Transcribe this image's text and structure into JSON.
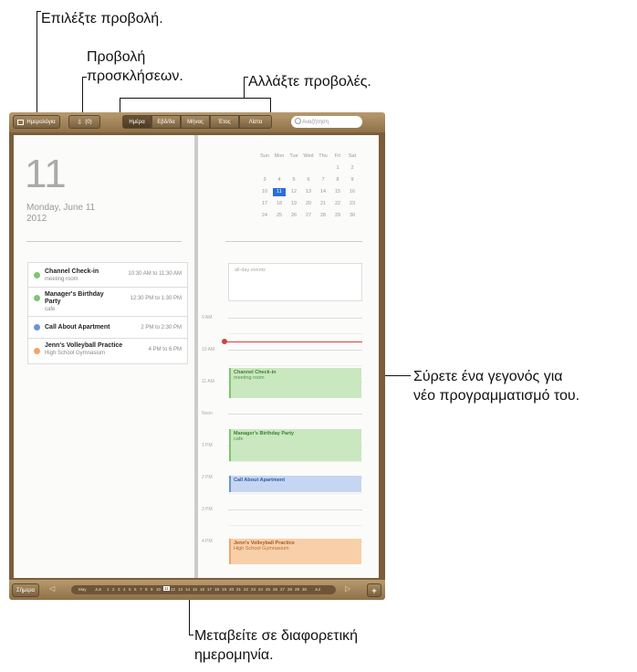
{
  "callouts": {
    "choose_view": "Επιλέξτε προβολή.",
    "invitations_view_line1": "Προβολή",
    "invitations_view_line2": "προσκλήσεων.",
    "change_views": "Αλλάξτε προβολές.",
    "drag_event_line1": "Σύρετε ένα γεγονός για",
    "drag_event_line2": "νέο προγραμματισμό του.",
    "go_date_line1": "Μεταβείτε σε διαφορετική",
    "go_date_line2": "ημερομηνία."
  },
  "toolbar": {
    "calendars_label": "Ημερολόγια",
    "inbox_label": "(0)",
    "segments": [
      "Ημέρα",
      "Εβδ/δα",
      "Μήνας",
      "Έτος",
      "Λίστα"
    ],
    "active_segment": "Ημέρα",
    "search_placeholder": "Αναζήτηση"
  },
  "left_page": {
    "day_number": "11",
    "date_line": "Monday, June 11",
    "year": "2012",
    "events": [
      {
        "title": "Channel Check-in",
        "sub": "meeting room",
        "time": "10:30 AM to 11:30 AM",
        "color": "#7dc66e"
      },
      {
        "title": "Manager's Birthday",
        "title2": "Party",
        "sub": "cafe",
        "time": "12:30 PM to 1:30 PM",
        "color": "#7dc66e"
      },
      {
        "title": "Call About Apartment",
        "sub": "",
        "time": "2 PM to 2:30 PM",
        "color": "#6b93d6"
      },
      {
        "title": "Jenn's Volleyball Practice",
        "sub": "High School Gymnasium",
        "time": "4 PM to 6 PM",
        "color": "#f0a56a"
      }
    ]
  },
  "mini_calendar": {
    "weekdays": [
      "Sun",
      "Mon",
      "Tue",
      "Wed",
      "Thu",
      "Fri",
      "Sat"
    ],
    "rows": [
      [
        "",
        "",
        "",
        "",
        "",
        "1",
        "2"
      ],
      [
        "3",
        "4",
        "5",
        "6",
        "7",
        "8",
        "9"
      ],
      [
        "10",
        "11",
        "12",
        "13",
        "14",
        "15",
        "16"
      ],
      [
        "17",
        "18",
        "19",
        "20",
        "21",
        "22",
        "23"
      ],
      [
        "24",
        "25",
        "26",
        "27",
        "28",
        "29",
        "30"
      ]
    ],
    "selected": "11",
    "selected_color": "#2a6fd6"
  },
  "day_view": {
    "all_day_label": "all-day events",
    "hours": [
      "9 AM",
      "10 AM",
      "11 AM",
      "Noon",
      "1 PM",
      "2 PM",
      "3 PM",
      "4 PM"
    ],
    "events": [
      {
        "title": "Channel Check-in",
        "sub": "meeting room",
        "color": "#c9e8bf",
        "border": "#7dc66e"
      },
      {
        "title": "Manager's Birthday Party",
        "sub": "cafe",
        "color": "#c9e8bf",
        "border": "#7dc66e"
      },
      {
        "title": "Call About Apartment",
        "sub": "",
        "color": "#c6d6f2",
        "border": "#6b93d6"
      },
      {
        "title": "Jenn's Volleyball Practice",
        "sub": "High School Gymnasium",
        "color": "#f8cfa9",
        "border": "#f0a56a"
      }
    ]
  },
  "bottom_bar": {
    "today_label": "Σήμερα",
    "months_left": [
      "May",
      "Jun"
    ],
    "days": [
      "1",
      "2",
      "3",
      "4",
      "5",
      "6",
      "7",
      "8",
      "9",
      "10",
      "11",
      "12",
      "13",
      "14",
      "15",
      "16",
      "17",
      "18",
      "19",
      "20",
      "21",
      "22",
      "23",
      "24",
      "25",
      "26",
      "27",
      "28",
      "29",
      "30"
    ],
    "month_right": "Jul",
    "selected_day": "11",
    "add_label": "+"
  }
}
